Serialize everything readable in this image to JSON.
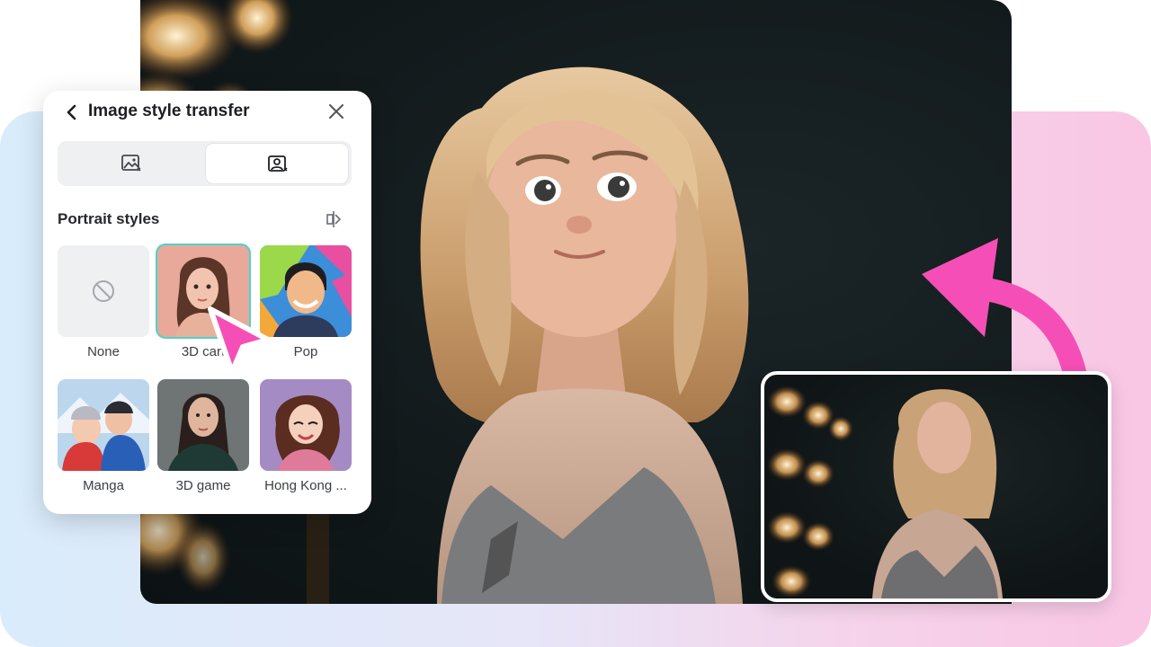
{
  "panel": {
    "title": "Image style transfer",
    "section_title": "Portrait styles",
    "tabs": [
      {
        "icon": "image-icon"
      },
      {
        "icon": "image-portrait-icon",
        "selected": true
      }
    ],
    "styles": [
      {
        "label": "None",
        "icon": "no-icon"
      },
      {
        "label": "3D cart",
        "selected": true
      },
      {
        "label": "Pop"
      },
      {
        "label": "Manga"
      },
      {
        "label": "3D game"
      },
      {
        "label": "Hong Kong ..."
      }
    ]
  },
  "colors": {
    "accent_pink": "#f54fb7",
    "selected_outline": "#4fd1cc"
  }
}
